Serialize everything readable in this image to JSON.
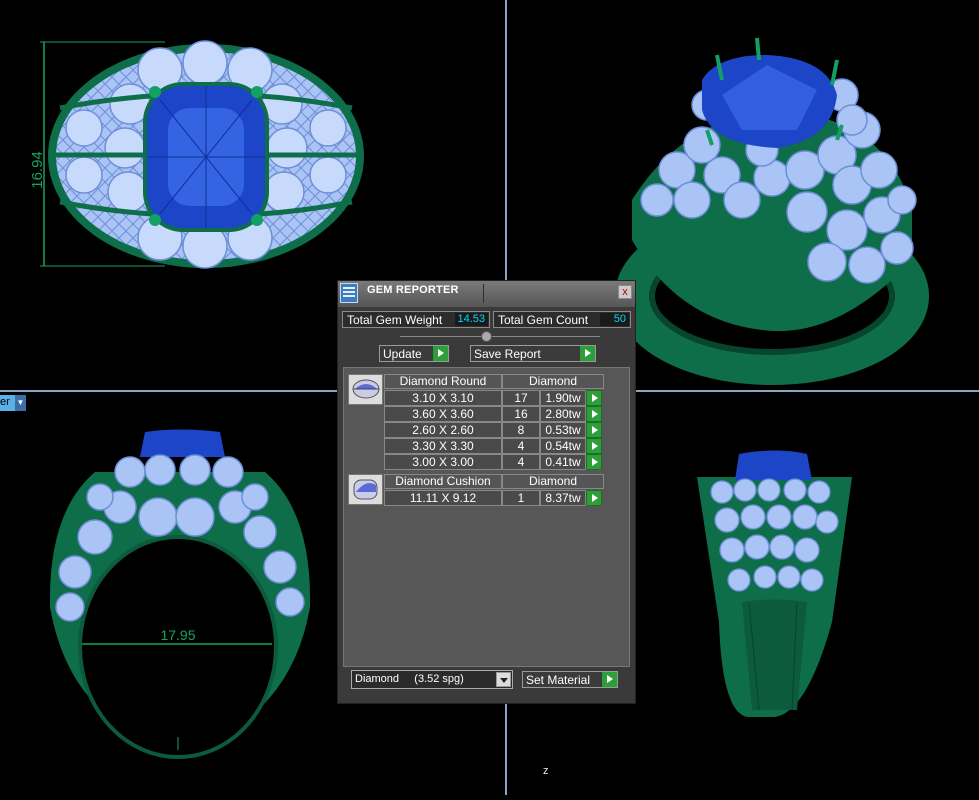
{
  "viewport": {
    "dropdown_text": "er",
    "axis_label": "z",
    "top_view_dimension": "16.94",
    "front_view_dimension": "17.95"
  },
  "gem_reporter": {
    "title": "GEM REPORTER",
    "close_label": "x",
    "total_weight_label": "Total Gem Weight",
    "total_weight_value": "14.53",
    "total_count_label": "Total Gem Count",
    "total_count_value": "50",
    "update_label": "Update",
    "save_report_label": "Save Report",
    "groups": [
      {
        "name": "Diamond Round",
        "material": "Diamond",
        "icon": "round-gem-icon",
        "rows": [
          {
            "size": "3.10 X 3.10",
            "count": "17",
            "weight": "1.90tw"
          },
          {
            "size": "3.60 X 3.60",
            "count": "16",
            "weight": "2.80tw"
          },
          {
            "size": "2.60 X 2.60",
            "count": "8",
            "weight": "0.53tw"
          },
          {
            "size": "3.30 X 3.30",
            "count": "4",
            "weight": "0.54tw"
          },
          {
            "size": "3.00 X 3.00",
            "count": "4",
            "weight": "0.41tw"
          }
        ]
      },
      {
        "name": "Diamond Cushion",
        "material": "Diamond",
        "icon": "cushion-gem-icon",
        "rows": [
          {
            "size": "11.11 X 9.12",
            "count": "1",
            "weight": "8.37tw"
          }
        ]
      }
    ],
    "material_select_value": "Diamond     (3.52 spg)",
    "set_material_label": "Set Material"
  },
  "colors": {
    "metal": "#0e6e4a",
    "metal_dark": "#07452d",
    "diamond": "#a9c4f5",
    "sapphire": "#1d45c8",
    "dimension": "#17a35c",
    "value_text": "#00d8ff",
    "go_button": "#2e9e3a"
  }
}
